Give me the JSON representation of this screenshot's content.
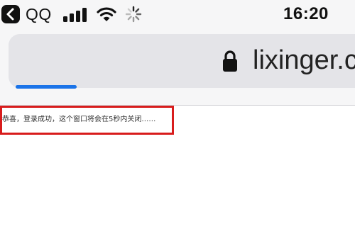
{
  "status_bar": {
    "back_app_label": "QQ",
    "time": "16:20",
    "icons": [
      "back-arrow-icon",
      "signal-icon",
      "wifi-icon",
      "loading-spinner-icon"
    ]
  },
  "browser": {
    "url_display": "lixinger.c",
    "lock_icon": "lock-icon",
    "load_progress_percent": 18,
    "progress_color": "#1a73e8"
  },
  "page": {
    "message": "恭喜，登录成功，这个窗口将会在5秒内关闭……",
    "highlight_color": "#d81c1c"
  }
}
